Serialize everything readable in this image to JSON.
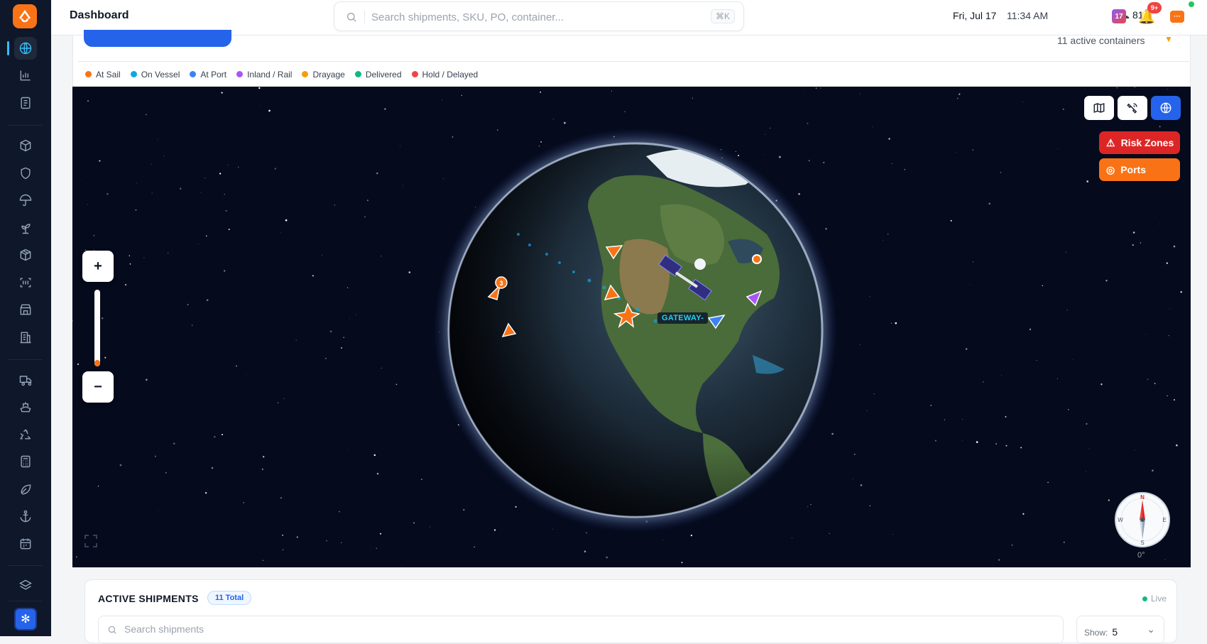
{
  "app": {
    "title": "Dashboard"
  },
  "search": {
    "placeholder": "Search shipments, SKU, PO, container...",
    "shortcut": "⌘K"
  },
  "header": {
    "date": "Fri, Jul 17",
    "time": "11:34 AM",
    "temperature": "81°",
    "calendar_day": "17",
    "notification_count": "9+"
  },
  "sidebar": {
    "items": [
      {
        "icon": "globe-icon",
        "active": true
      },
      {
        "icon": "bar-chart-icon"
      },
      {
        "icon": "document-icon"
      },
      {
        "icon": "box-icon"
      },
      {
        "icon": "shield-icon"
      },
      {
        "icon": "umbrella-icon"
      },
      {
        "icon": "sprout-icon"
      },
      {
        "icon": "package-icon"
      },
      {
        "icon": "scan-icon"
      },
      {
        "icon": "store-icon"
      },
      {
        "icon": "building-icon"
      },
      {
        "icon": "truck-icon"
      },
      {
        "icon": "ship-icon"
      },
      {
        "icon": "recycle-icon"
      },
      {
        "icon": "calculator-icon"
      },
      {
        "icon": "leaf-icon"
      },
      {
        "icon": "anchor-icon"
      },
      {
        "icon": "calendar-icon"
      },
      {
        "icon": "layers-icon"
      }
    ]
  },
  "map_panel": {
    "active_containers": "11 active containers",
    "legend": [
      {
        "label": "At Sail",
        "color": "#f97316"
      },
      {
        "label": "On Vessel",
        "color": "#0ea5e9"
      },
      {
        "label": "At Port",
        "color": "#3b82f6"
      },
      {
        "label": "Inland / Rail",
        "color": "#a855f7"
      },
      {
        "label": "Drayage",
        "color": "#f59e0b"
      },
      {
        "label": "Delivered",
        "color": "#10b981"
      },
      {
        "label": "Hold / Delayed",
        "color": "#ef4444"
      }
    ],
    "zoom": {
      "in": "+",
      "out": "−",
      "level": 0.08
    },
    "layers": {
      "risk_zones": "Risk Zones",
      "ports": "Ports"
    },
    "cluster_count": "3",
    "gateway_label": "GATEWAY-",
    "compass": {
      "n": "N",
      "e": "E",
      "s": "S",
      "w": "W",
      "heading": "0°"
    }
  },
  "shipments": {
    "title": "ACTIVE SHIPMENTS",
    "total": "11 Total",
    "live": "Live",
    "search_placeholder": "Search shipments",
    "show_label": "Show:",
    "show_value": "5"
  }
}
